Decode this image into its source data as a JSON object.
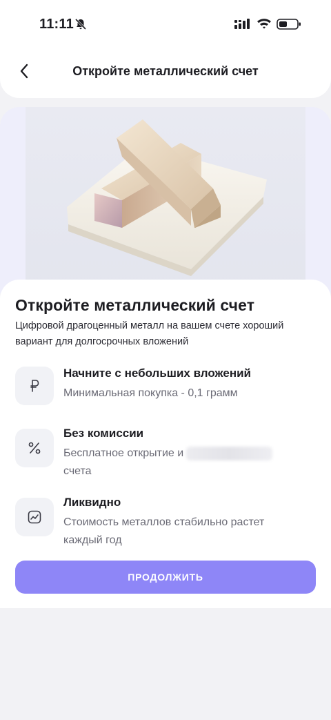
{
  "status_bar": {
    "time": "11:11",
    "icons": [
      "bell-off-icon",
      "cellular-signal-icon",
      "wifi-icon",
      "battery-icon"
    ]
  },
  "header": {
    "back_icon": "chevron-left-icon",
    "title": "Откройте металлический счет"
  },
  "hero": {
    "image": "gold-bars-illustration"
  },
  "content": {
    "title": "Откройте металлический счет",
    "subtitle": "Цифровой драгоценный металл на вашем счете хороший вариант для долгосрочных вложений",
    "features": [
      {
        "icon": "ruble-icon",
        "title": "Начните с небольших вложений",
        "description": "Минимальная покупка - 0,1 грамм"
      },
      {
        "icon": "percent-icon",
        "title": "Без комиссии",
        "description_part1": "Бесплатное открытие и",
        "description_part2": "счета"
      },
      {
        "icon": "chart-trend-icon",
        "title": "Ликвидно",
        "description": "Стоимость металлов стабильно растет каждый год"
      }
    ],
    "continue_label": "ПРОДОЛЖИТЬ"
  },
  "colors": {
    "accent": "#8e86f7",
    "background": "#f2f2f5",
    "card": "#ffffff",
    "icon_box": "#f1f2f6"
  }
}
